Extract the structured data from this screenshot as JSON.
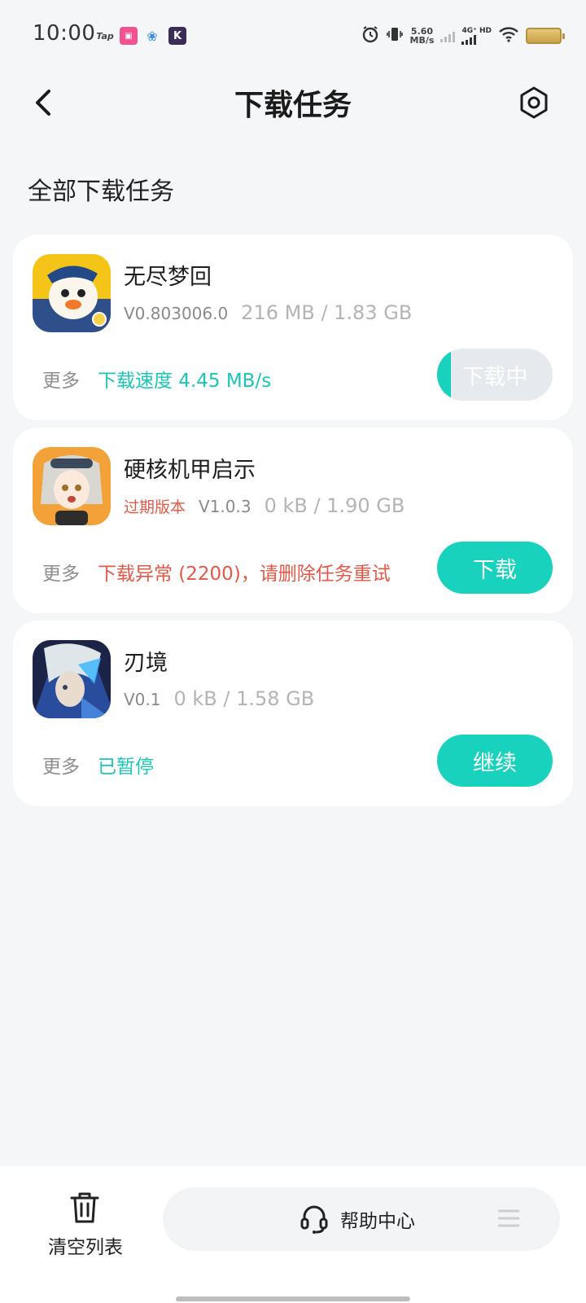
{
  "status_bar": {
    "time": "10:00",
    "notifications": [
      "Tap",
      "bili",
      "flower",
      "K"
    ],
    "net_speed_value": "5.60",
    "net_speed_unit": "MB/s",
    "network_type": "4G⁺ HD"
  },
  "header": {
    "title": "下载任务",
    "back_icon": "chevron-left-icon",
    "settings_icon": "gear-icon"
  },
  "section_title": "全部下载任务",
  "tasks": [
    {
      "name": "无尽梦回",
      "expired_label": "",
      "version": "V0.803006.0",
      "size": "216 MB / 1.83 GB",
      "more": "更多",
      "status": "下载速度 4.45 MB/s",
      "status_color": "#1ec4b6",
      "button": "下载中",
      "progress_fraction": 0.118
    },
    {
      "name": "硬核机甲启示",
      "expired_label": "过期版本",
      "version": "V1.0.3",
      "size": "0 kB / 1.90 GB",
      "more": "更多",
      "status": "下载异常 (2200)，请删除任务重试",
      "status_color": "#e05a4a",
      "button": "下载"
    },
    {
      "name": "刃境",
      "expired_label": "",
      "version": "V0.1",
      "size": "0 kB / 1.58 GB",
      "more": "更多",
      "status": "已暂停",
      "status_color": "#1ec4b6",
      "button": "继续"
    }
  ],
  "bottom_bar": {
    "clear_label": "清空列表",
    "help_label": "帮助中心"
  },
  "colors": {
    "accent": "#18d2bd",
    "error": "#e05a4a",
    "background": "#f5f6f8"
  }
}
